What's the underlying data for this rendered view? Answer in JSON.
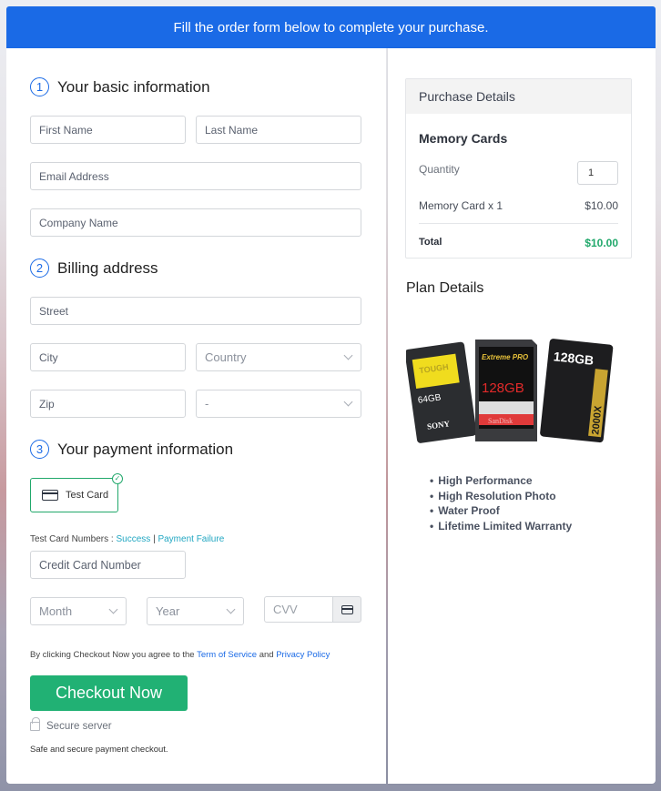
{
  "banner": {
    "text": "Fill the order form below to complete your purchase."
  },
  "basic_info": {
    "step": "1",
    "title": "Your basic information",
    "first_name_placeholder": "First Name",
    "last_name_placeholder": "Last Name",
    "email_placeholder": "Email Address",
    "company_placeholder": "Company Name"
  },
  "billing": {
    "step": "2",
    "title": "Billing address",
    "street_placeholder": "Street",
    "city_placeholder": "City",
    "country_selected": "Country",
    "zip_placeholder": "Zip",
    "state_selected": "-"
  },
  "payment": {
    "step": "3",
    "title": "Your payment information",
    "method_label": "Test Card",
    "test_numbers_label": "Test Card Numbers :",
    "success_link": "Success",
    "separator": "|",
    "failure_link": "Payment Failure",
    "card_number_placeholder": "Credit Card Number",
    "month_selected": "Month",
    "year_selected": "Year",
    "cvv_placeholder": "CVV"
  },
  "agreement": {
    "prefix": "By clicking Checkout Now you agree to the",
    "terms_link": "Term of Service",
    "and": "and",
    "privacy_link": "Privacy Policy"
  },
  "checkout": {
    "button_label": "Checkout Now",
    "secure_label": "Secure server",
    "safe_text": "Safe and secure payment checkout."
  },
  "purchase_details": {
    "header": "Purchase Details",
    "product_title": "Memory Cards",
    "quantity_label": "Quantity",
    "quantity_value": "1",
    "line_item_label": "Memory Card x 1",
    "line_item_price": "$10.00",
    "total_label": "Total",
    "total_value": "$10.00",
    "total_color": "#21a86b"
  },
  "plan_details": {
    "title": "Plan Details",
    "image_alt": "SD memory cards (Sony TOUGH 64GB, SanDisk Extreme PRO 128GB, 128GB 2000x)",
    "card_texts": [
      "TOUGH",
      "64GB",
      "SONY",
      "Extreme PRO",
      "128GB",
      "SanDisk",
      "128GB",
      "2000X"
    ],
    "features": [
      "High Performance",
      "High Resolution Photo",
      "Water Proof",
      "Lifetime Limited Warranty"
    ]
  },
  "colors": {
    "primary": "#1a6ae6",
    "success": "#21b174",
    "link": "#22a7c2"
  }
}
